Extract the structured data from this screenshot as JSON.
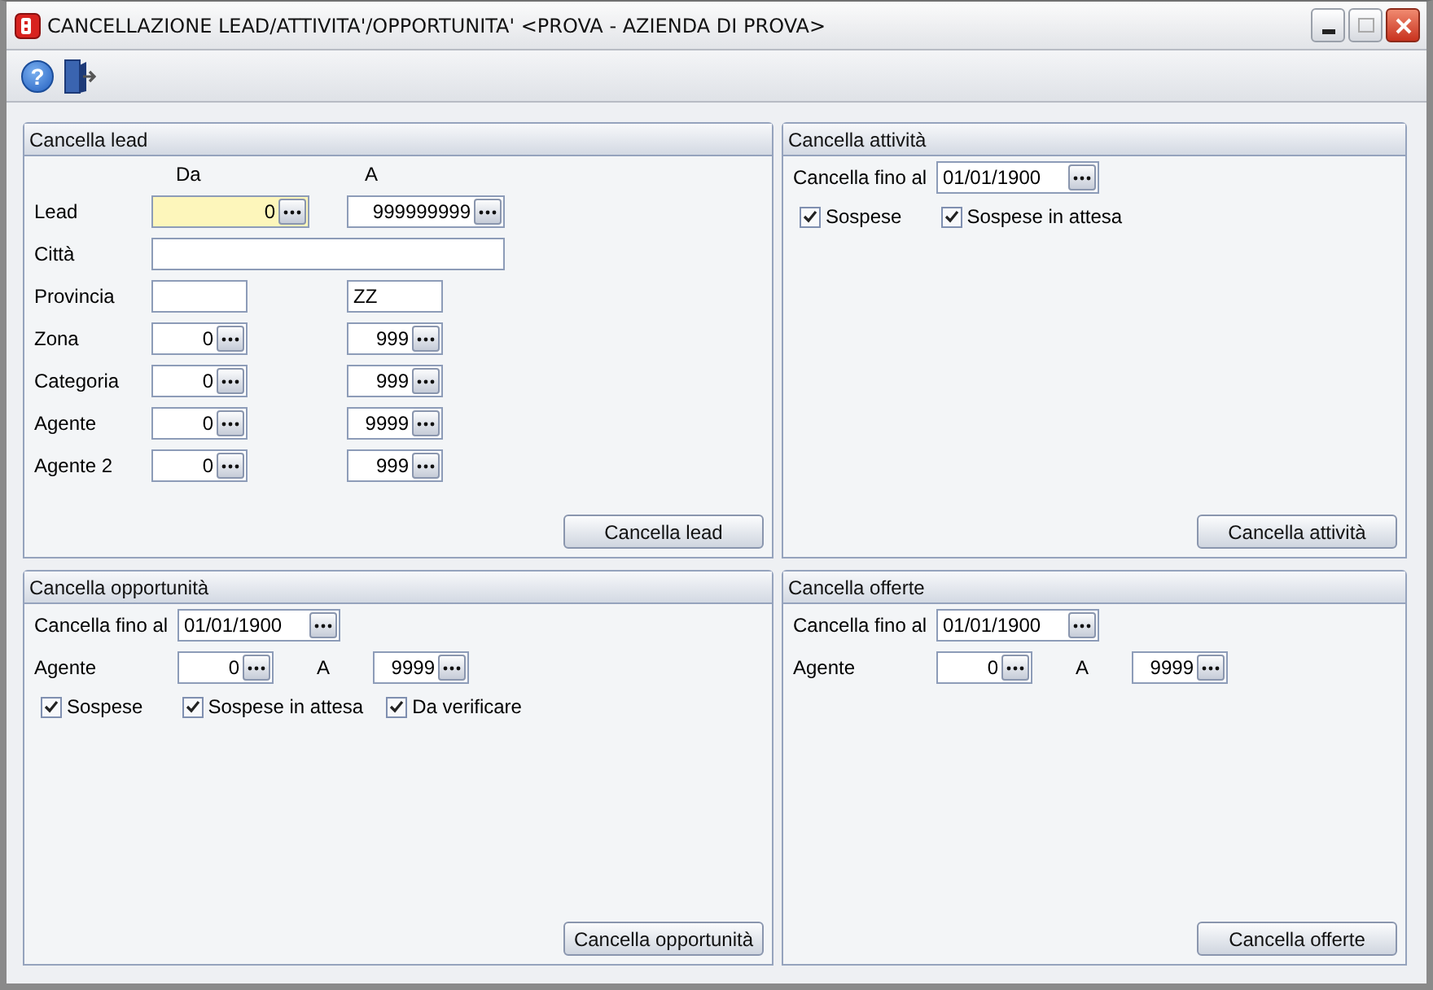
{
  "window": {
    "title": "CANCELLAZIONE LEAD/ATTIVITA'/OPPORTUNITA' <PROVA - AZIENDA DI PROVA>"
  },
  "toolbar": [
    {
      "kind": "help",
      "glyph": "?"
    },
    {
      "kind": "exit"
    }
  ],
  "panels": [
    {
      "kind": "lead",
      "title": "Cancella lead",
      "col_from": "Da",
      "col_to": "A",
      "rows": [
        {
          "kind": "wide",
          "label": "Lead",
          "from": "0",
          "to": "999999999",
          "focused": true
        },
        {
          "kind": "text",
          "label": "Città"
        },
        {
          "kind": "plain",
          "label": "Provincia",
          "to": "ZZ"
        },
        {
          "kind": "range",
          "label": "Zona",
          "from": "0",
          "to": "999"
        },
        {
          "kind": "range",
          "label": "Categoria",
          "from": "0",
          "to": "999"
        },
        {
          "kind": "range",
          "label": "Agente",
          "from": "0",
          "to": "9999"
        },
        {
          "kind": "range",
          "label": "Agente 2",
          "from": "0",
          "to": "999"
        }
      ],
      "button": "Cancella lead"
    },
    {
      "kind": "dated",
      "title": "Cancella attività",
      "date_label": "Cancella fino al",
      "date": "01/01/1900",
      "checkboxes": [
        {
          "label": "Sospese",
          "checked": true
        },
        {
          "label": "Sospese in attesa",
          "checked": true
        }
      ],
      "button": "Cancella attività"
    },
    {
      "kind": "dated",
      "title": "Cancella opportunità",
      "date_label": "Cancella fino al",
      "date": "01/01/1900",
      "agent": {
        "label": "Agente",
        "from": "0",
        "sep": "A",
        "to": "9999"
      },
      "checkboxes": [
        {
          "label": "Sospese",
          "checked": true
        },
        {
          "label": "Sospese in attesa",
          "checked": true
        },
        {
          "label": "Da verificare",
          "checked": true
        }
      ],
      "button": "Cancella opportunità"
    },
    {
      "kind": "dated",
      "title": "Cancella offerte",
      "date_label": "Cancella fino al",
      "date": "01/01/1900",
      "agent": {
        "label": "Agente",
        "from": "0",
        "sep": "A",
        "to": "9999"
      },
      "button": "Cancella offerte"
    }
  ]
}
